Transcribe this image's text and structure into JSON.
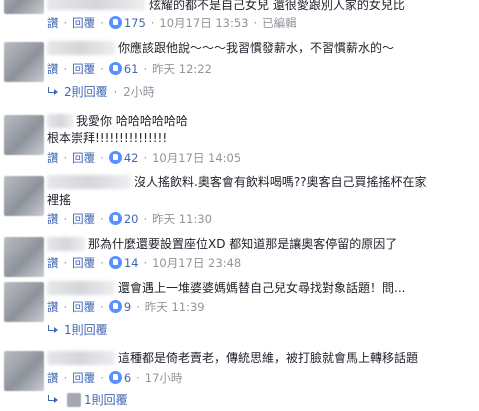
{
  "comments": [
    {
      "text": "炫耀的都不是自己女兒 還很愛跟別人家的女兒比",
      "action_label": "讚",
      "reply_label": "回覆",
      "likes": "175",
      "time": "10月17日 13:53",
      "edited": "已編輯"
    },
    {
      "text": "你應該跟他說～～～我習慣發薪水，不習慣薪水的～",
      "action_label": "讚",
      "reply_label": "回覆",
      "likes": "61",
      "time": "昨天 12:22",
      "replies": {
        "label": "2則回覆",
        "time": "2小時"
      }
    },
    {
      "text": "我愛你 哈哈哈哈哈哈",
      "text2": "根本崇拜!!!!!!!!!!!!!!!",
      "action_label": "讚",
      "reply_label": "回覆",
      "likes": "42",
      "time": "10月17日 14:05"
    },
    {
      "text": "沒人搖飲料.奧客會有飲料喝嗎??奧客自己買搖搖杯在家",
      "text2": "裡搖",
      "action_label": "讚",
      "reply_label": "回覆",
      "likes": "20",
      "time": "昨天 11:30"
    },
    {
      "text": "那為什麼還要設置座位XD 都知道那是讓奧客停留的原因了",
      "action_label": "讚",
      "reply_label": "回覆",
      "likes": "14",
      "time": "10月17日 23:48"
    },
    {
      "text": "還會遇上一堆婆婆媽媽替自己兒女尋找對象話題！問...",
      "action_label": "讚",
      "reply_label": "回覆",
      "likes": "9",
      "time": "昨天 11:39",
      "replies": {
        "label": "1則回覆"
      }
    },
    {
      "text": "這種都是倚老賣老，傳統思維，被打臉就會馬上轉移話題",
      "action_label": "讚",
      "reply_label": "回覆",
      "likes": "6",
      "time": "17小時",
      "replies": {
        "label": "1則回覆"
      }
    }
  ],
  "colors": {
    "link": "#4267b2",
    "meta": "#90949c",
    "like_badge": "#5890ff"
  }
}
